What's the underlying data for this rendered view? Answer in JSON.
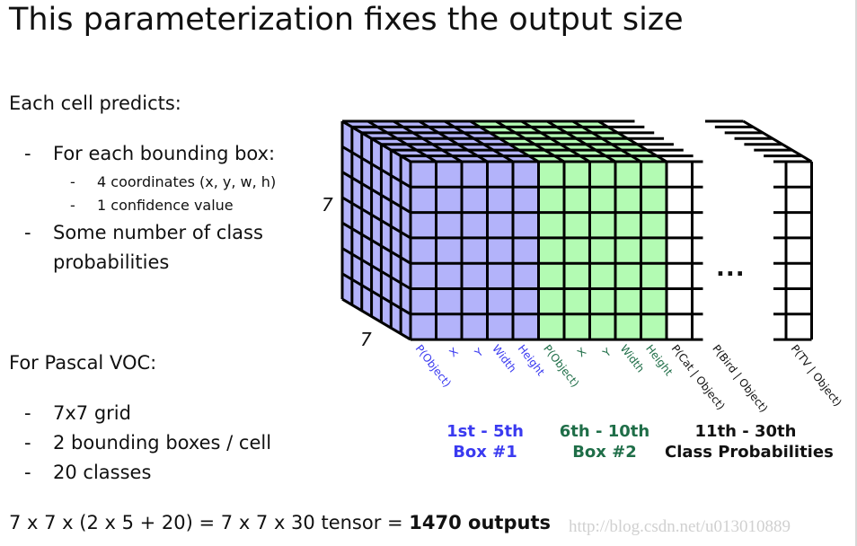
{
  "slide": {
    "title": "This parameterization fixes the output size",
    "section1": {
      "heading": "Each cell predicts:",
      "items": [
        {
          "text": "For each bounding box:",
          "subitems": [
            "4 coordinates (x, y, w, h)",
            "1 confidence value"
          ]
        },
        {
          "text": "Some number of class",
          "text2": "probabilities"
        }
      ]
    },
    "section2": {
      "heading": "For Pascal VOC:",
      "items": [
        "7x7 grid",
        "2 bounding boxes / cell",
        "20 classes"
      ]
    },
    "formula": "7 x 7 x (2 x 5 + 20) = 7 x 7 x 30 tensor = ",
    "formula_bold": "1470 outputs",
    "dash": "-"
  },
  "diagram": {
    "grid_height_label": "7",
    "grid_width_label": "7",
    "ellipsis": "...",
    "colors": {
      "box1_fill": "#b3b3fa",
      "box2_fill": "#b3fbb3",
      "box1_text": "#3a3af0",
      "box2_text": "#1f6e48",
      "class_text": "#111111"
    },
    "channel_labels": [
      {
        "text": "P(Object)",
        "group": "box1"
      },
      {
        "text": "X",
        "group": "box1"
      },
      {
        "text": "Y",
        "group": "box1"
      },
      {
        "text": "Width",
        "group": "box1"
      },
      {
        "text": "Height",
        "group": "box1"
      },
      {
        "text": "P(Object)",
        "group": "box2"
      },
      {
        "text": "X",
        "group": "box2"
      },
      {
        "text": "Y",
        "group": "box2"
      },
      {
        "text": "Width",
        "group": "box2"
      },
      {
        "text": "Height",
        "group": "box2"
      },
      {
        "text": "P(Cat | Object)",
        "group": "class"
      },
      {
        "text": "P(Bird | Object)",
        "group": "class"
      },
      {
        "text": "P(TV | Object)",
        "group": "class"
      }
    ],
    "groups": [
      {
        "range": "1st - 5th",
        "name": "Box #1"
      },
      {
        "range": "6th - 10th",
        "name": "Box #2"
      },
      {
        "range": "11th - 30th",
        "name": "Class Probabilities"
      }
    ]
  },
  "watermark": "http://blog.csdn.net/u013010889"
}
